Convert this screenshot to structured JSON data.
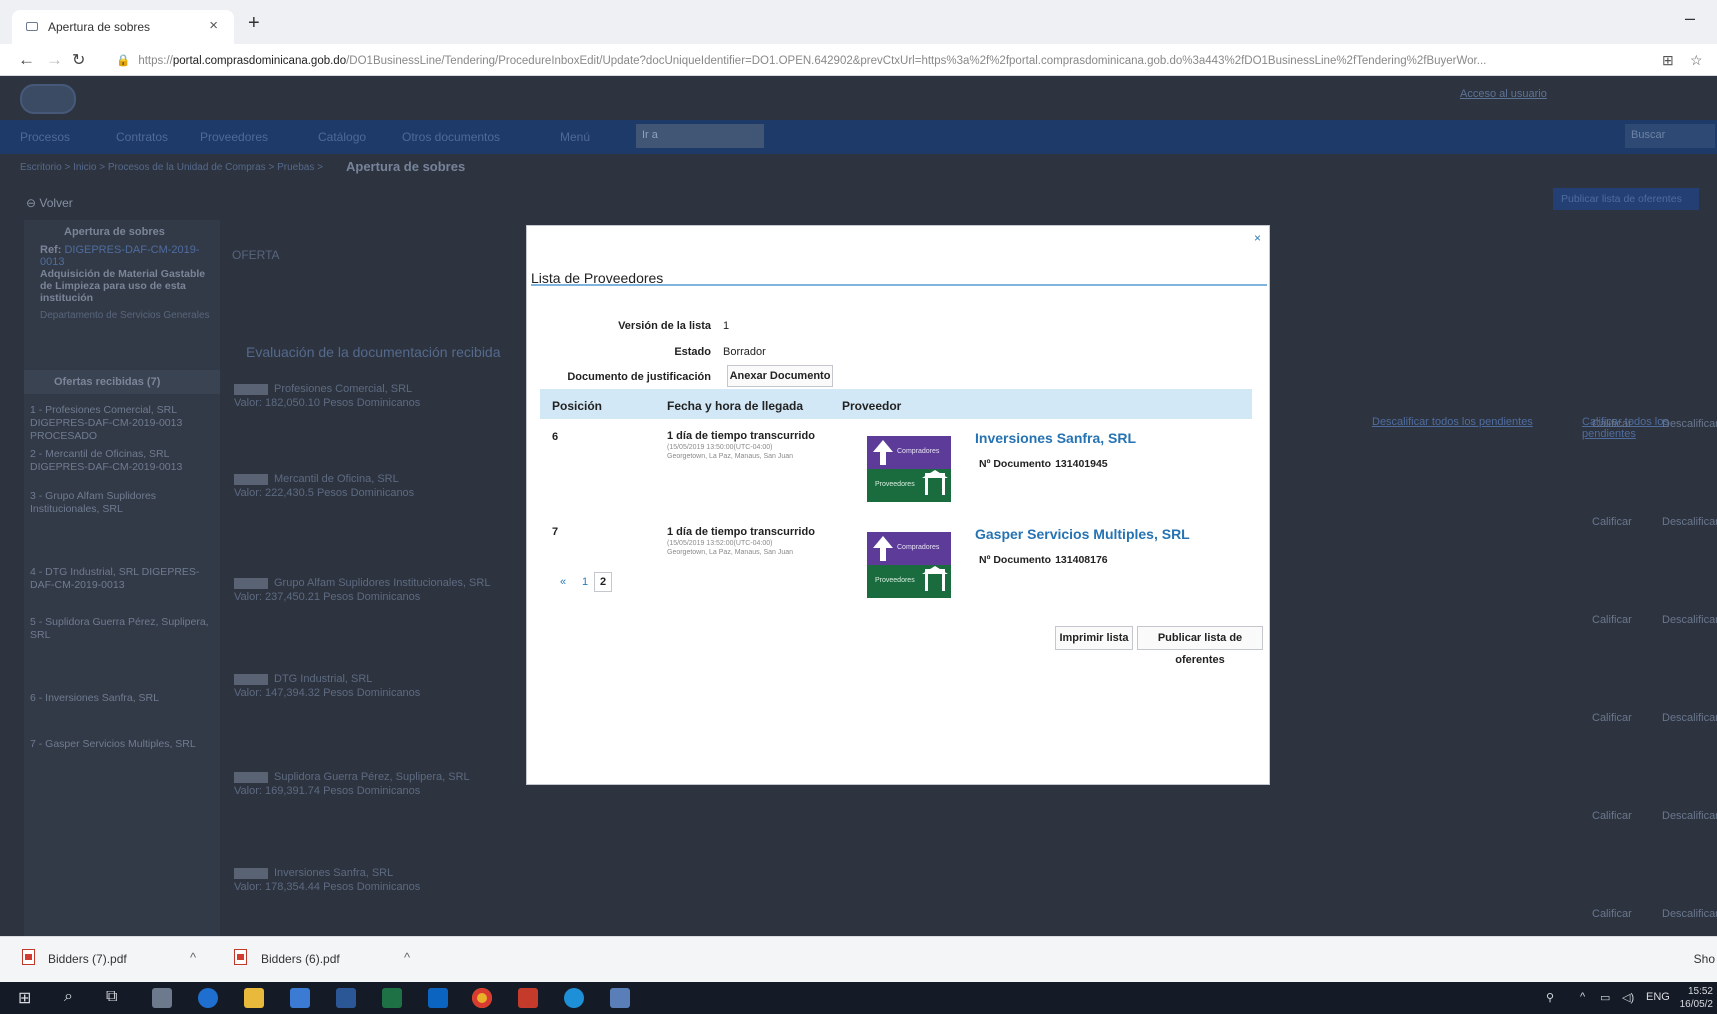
{
  "browser": {
    "tab_title": "Apertura de sobres",
    "tab_close": "×",
    "new_tab": "+",
    "minimize": "–",
    "url_scheme": "https://",
    "url_host": "portal.comprasdominicana.gob.do",
    "url_path": "/DO1BusinessLine/Tendering/ProcedureInboxEdit/Update?docUniqueIdentifier=DO1.OPEN.642902&prevCtxUrl=https%3a%2f%2fportal.comprasdominicana.gob.do%3a443%2fDO1BusinessLine%2fTendering%2fBuyerWor..."
  },
  "page": {
    "top_link": "Acceso al usuario",
    "menu_items": [
      "Procesos",
      "Contratos",
      "Proveedores",
      "Catálogo",
      "Otros documentos",
      "Menú"
    ],
    "menu_select": "Ir a",
    "search_placeholder": "Buscar",
    "breadcrumb": "Escritorio > Inicio > Procesos de la Unidad de Compras > Pruebas >",
    "breadcrumb_current": "Apertura de sobres",
    "back_label": "Volver",
    "publish_button": "Publicar lista de oferentes",
    "left": {
      "title": "Apertura de sobres",
      "ref_label": "Ref:",
      "ref_value": "DIGEPRES-DAF-CM-2019-0013",
      "description": "Adquisición de Material Gastable de Limpieza para uso de esta institución",
      "department": "Departamento de Servicios Generales",
      "offers_header": "Ofertas recibidas (7)",
      "items": [
        "1 - Profesiones Comercial, SRL DIGEPRES-DAF-CM-2019-0013 PROCESADO",
        "2 - Mercantil de Oficinas, SRL DIGEPRES-DAF-CM-2019-0013",
        "3 - Grupo Alfam Suplidores Institucionales, SRL",
        "4 - DTG Industrial, SRL DIGEPRES-DAF-CM-2019-0013",
        "5 - Suplidora Guerra Pérez, Suplipera, SRL",
        "6 - Inversiones Sanfra, SRL",
        "7 - Gasper Servicios Multiples, SRL"
      ]
    },
    "offer_title": "OFERTA",
    "eval_title": "Evaluación de la documentación recibida",
    "mid_rows": [
      {
        "name": "Profesiones Comercial, SRL",
        "value": "Valor: 182,050.10 Pesos Dominicanos"
      },
      {
        "name": "Mercantil de Oficina, SRL",
        "value": "Valor: 222,430.5 Pesos Dominicanos"
      },
      {
        "name": "Grupo Alfam Suplidores Institucionales, SRL",
        "value": "Valor: 237,450.21 Pesos Dominicanos"
      },
      {
        "name": "DTG Industrial, SRL",
        "value": "Valor: 147,394.32 Pesos Dominicanos"
      },
      {
        "name": "Suplidora Guerra Pérez, Suplipera, SRL",
        "value": "Valor: 169,391.74 Pesos Dominicanos"
      },
      {
        "name": "Inversiones Sanfra, SRL",
        "value": "Valor: 178,354.44 Pesos Dominicanos"
      }
    ],
    "right_link": "Descalificar todos los pendientes",
    "right_link2": "Calificar todos los pendientes",
    "calificar": "Calificar",
    "descalificar": "Descalificar"
  },
  "modal": {
    "close": "×",
    "heading": "Lista de Proveedores",
    "version_label": "Versión de la lista",
    "version_value": "1",
    "state_label": "Estado",
    "state_value": "Borrador",
    "justification_label": "Documento de justificación",
    "attach_button": "Anexar Documento",
    "columns": [
      "Posición",
      "Fecha y hora de llegada",
      "Proveedor"
    ],
    "rows": [
      {
        "position": "6",
        "elapsed": "1 día de tiempo transcurrido",
        "timestamp": "(15/05/2019 13:50:00(UTC-04:00)",
        "zone": "Georgetown, La Paz, Manaus, San Juan",
        "badge_top": "Compradores",
        "badge_bottom": "Proveedores",
        "supplier": "Inversiones Sanfra, SRL",
        "doc_label": "Nº Documento",
        "doc_number": "131401945"
      },
      {
        "position": "7",
        "elapsed": "1 día de tiempo transcurrido",
        "timestamp": "(15/05/2019 13:52:00(UTC-04:00)",
        "zone": "Georgetown, La Paz, Manaus, San Juan",
        "badge_top": "Compradores",
        "badge_bottom": "Proveedores",
        "supplier": "Gasper Servicios Multiples, SRL",
        "doc_label": "Nº Documento",
        "doc_number": "131408176"
      }
    ],
    "pager": {
      "prev": "«",
      "page1": "1",
      "page2": "2"
    },
    "print_button": "Imprimir lista",
    "publish_button": "Publicar lista de oferentes"
  },
  "downloads": {
    "items": [
      "Bidders (7).pdf",
      "Bidders (6).pdf"
    ],
    "show_all": "Sho"
  },
  "taskbar": {
    "lang": "ENG",
    "time": "15:52",
    "date": "16/05/2"
  }
}
